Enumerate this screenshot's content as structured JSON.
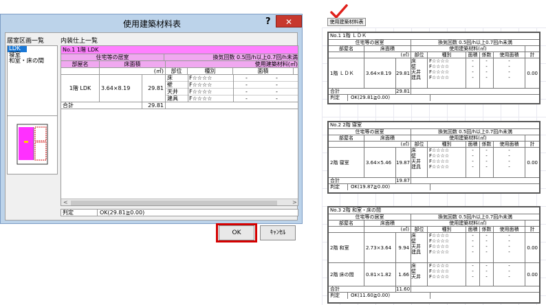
{
  "dialog": {
    "title": "使用建築材料表",
    "help": "?",
    "close": "✕",
    "left_label": "居室区画一覧",
    "right_label": "内装仕上一覧",
    "rooms": [
      "LDK",
      "寝室",
      "和室・床の間"
    ],
    "grid": {
      "title_row": "No.1 1階 LDK",
      "row2": {
        "left": "住宅等の居室",
        "right": "換気回数 0.5回/h以上0.7回/h未満"
      },
      "header": {
        "room": "部屋名",
        "area": "床面積",
        "unit": "(㎡)",
        "part": "部位",
        "kind": "種別",
        "material": "使用建築材料(㎡)",
        "mat_area": "面積"
      },
      "room_name": "1階 LDK",
      "dims": "3.64×8.19",
      "area": "29.81",
      "rows": [
        {
          "part": "床",
          "kind": "F☆☆☆☆",
          "a": "-",
          "b": "-"
        },
        {
          "part": "壁",
          "kind": "F☆☆☆☆",
          "a": "-",
          "b": "-"
        },
        {
          "part": "天井",
          "kind": "F☆☆☆☆",
          "a": "-",
          "b": "-"
        },
        {
          "part": "建具",
          "kind": "F☆☆☆☆",
          "a": "-",
          "b": "-"
        }
      ],
      "total_label": "合計",
      "total_value": "29.81"
    },
    "judge_label": "判定",
    "judge_value": "OK(29.81≧0.00)",
    "ok": "OK",
    "cancel": "ｷｬﾝｾﾙ"
  },
  "right_panel": {
    "button": "使用建築材料表",
    "sheets": [
      {
        "title": "No.1 1階 ＬＤＫ",
        "category": "住宅等の居室",
        "ventilation": "換気回数 0.5回/h以上0.7回/h未満",
        "h": {
          "room": "部屋名",
          "area": "床面積",
          "material": "使用建築材料(㎡)",
          "unit": "(㎡)",
          "part": "部位",
          "kind": "種別",
          "mat_area": "面積",
          "coef": "係数",
          "used": "使用面積",
          "sum": "計"
        },
        "groups": [
          {
            "name": "1階 ＬＤＫ",
            "dims": "3.64×8.19",
            "area": "29.81",
            "rows": [
              {
                "part": "床",
                "kind": "F☆☆☆☆",
                "a": "-",
                "c": "-",
                "u": "-"
              },
              {
                "part": "壁",
                "kind": "F☆☆☆☆",
                "a": "-",
                "c": "-",
                "u": "-"
              },
              {
                "part": "天井",
                "kind": "F☆☆☆☆",
                "a": "-",
                "c": "-",
                "u": "-"
              },
              {
                "part": "建具",
                "kind": "F☆☆☆☆",
                "a": "-",
                "c": "-",
                "u": "-"
              }
            ],
            "sum": "0.00"
          }
        ],
        "total_label": "合計",
        "total_value": "29.81",
        "judge_label": "判定",
        "judge_value": "OK(29.81≧0.00)"
      },
      {
        "title": "No.2 2階 寝室",
        "category": "住宅等の居室",
        "ventilation": "換気回数 0.5回/h以上0.7回/h未満",
        "h": {
          "room": "部屋名",
          "area": "床面積",
          "material": "使用建築材料(㎡)",
          "unit": "(㎡)",
          "part": "部位",
          "kind": "種別",
          "mat_area": "面積",
          "coef": "係数",
          "used": "使用面積",
          "sum": "計"
        },
        "groups": [
          {
            "name": "2階 寝室",
            "dims": "3.64×5.46",
            "area": "19.87",
            "rows": [
              {
                "part": "床",
                "kind": "F☆☆☆☆",
                "a": "-",
                "c": "-",
                "u": "-"
              },
              {
                "part": "壁",
                "kind": "F☆☆☆☆",
                "a": "-",
                "c": "-",
                "u": "-"
              },
              {
                "part": "天井",
                "kind": "F☆☆☆☆",
                "a": "-",
                "c": "-",
                "u": "-"
              },
              {
                "part": "建具",
                "kind": "F☆☆☆☆",
                "a": "-",
                "c": "-",
                "u": "-"
              }
            ],
            "sum": "0.00"
          }
        ],
        "total_label": "合計",
        "total_value": "19.87",
        "judge_label": "判定",
        "judge_value": "OK(19.87≧0.00)"
      },
      {
        "title": "No.3 2階 和室・床の間",
        "category": "住宅等の居室",
        "ventilation": "換気回数 0.5回/h以上0.7回/h未満",
        "h": {
          "room": "部屋名",
          "area": "床面積",
          "material": "使用建築材料(㎡)",
          "unit": "(㎡)",
          "part": "部位",
          "kind": "種別",
          "mat_area": "面積",
          "coef": "係数",
          "used": "使用面積",
          "sum": "計"
        },
        "groups": [
          {
            "name": "2階 和室",
            "dims": "2.73×3.64",
            "area": "9.94",
            "rows": [
              {
                "part": "床",
                "kind": "F☆☆☆☆",
                "a": "-",
                "c": "-",
                "u": "-"
              },
              {
                "part": "壁",
                "kind": "F☆☆☆☆",
                "a": "-",
                "c": "-",
                "u": "-"
              },
              {
                "part": "天井",
                "kind": "F☆☆☆☆",
                "a": "-",
                "c": "-",
                "u": "-"
              },
              {
                "part": "建具",
                "kind": "F☆☆☆☆",
                "a": "-",
                "c": "-",
                "u": "-"
              }
            ],
            "sum": "0.00"
          },
          {
            "name": "2階 床の間",
            "dims": "0.81×1.82",
            "area": "1.66",
            "rows": [
              {
                "part": "床",
                "kind": "F☆☆☆☆",
                "a": "-",
                "c": "-",
                "u": "-"
              },
              {
                "part": "壁",
                "kind": "F☆☆☆☆",
                "a": "-",
                "c": "-",
                "u": "-"
              },
              {
                "part": "天井",
                "kind": "F☆☆☆☆",
                "a": "-",
                "c": "-",
                "u": "-"
              }
            ],
            "sum": "0.00"
          }
        ],
        "total_label": "合計",
        "total_value": "11.60",
        "judge_label": "判定",
        "judge_value": "OK(11.60≧0.00)"
      }
    ]
  },
  "colors": {
    "accent_red": "#d40000",
    "check_red": "#e0201a",
    "pink": "#f0a8f0",
    "selection_blue": "#1a78d6"
  }
}
